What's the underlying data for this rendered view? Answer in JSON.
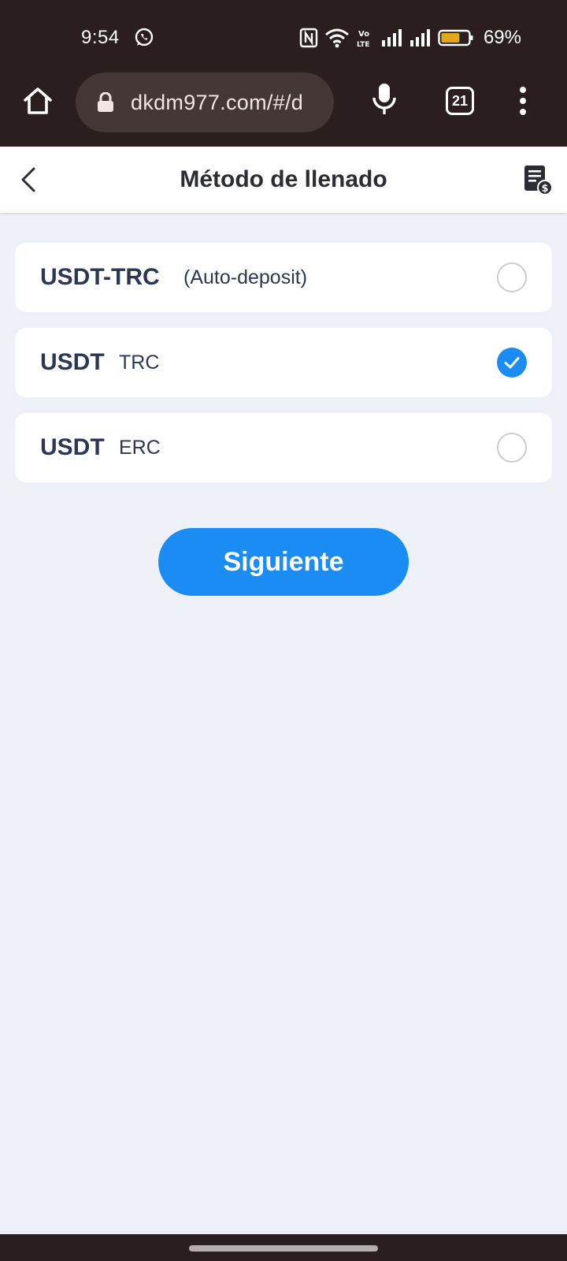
{
  "status_bar": {
    "time": "9:54",
    "battery_percent": "69%",
    "battery_level": 0.69,
    "icons": [
      "whatsapp-icon",
      "nfc-icon",
      "wifi-icon",
      "volte-icon",
      "signal-icon",
      "signal-icon",
      "battery-icon"
    ],
    "volte_label": "Vo LTE"
  },
  "browser": {
    "url": "dkdm977.com/#/d",
    "tab_count": "21",
    "icons": [
      "home-icon",
      "lock-icon",
      "mic-icon",
      "more-vert-icon"
    ]
  },
  "header": {
    "title": "Método de llenado",
    "icons": [
      "chevron-left-icon",
      "receipt-dollar-icon"
    ]
  },
  "options": [
    {
      "main": "USDT-TRC",
      "sub": "(Auto-deposit)",
      "selected": false
    },
    {
      "main": "USDT",
      "sub": "TRC",
      "selected": true
    },
    {
      "main": "USDT",
      "sub": "ERC",
      "selected": false
    }
  ],
  "next_button": {
    "label": "Siguiente"
  },
  "colors": {
    "accent": "#1a8cf3",
    "system_bar": "#2a1f1e",
    "page_background": "#edf0f7",
    "text_dark": "#2b3753",
    "battery": "#e0a81a"
  }
}
